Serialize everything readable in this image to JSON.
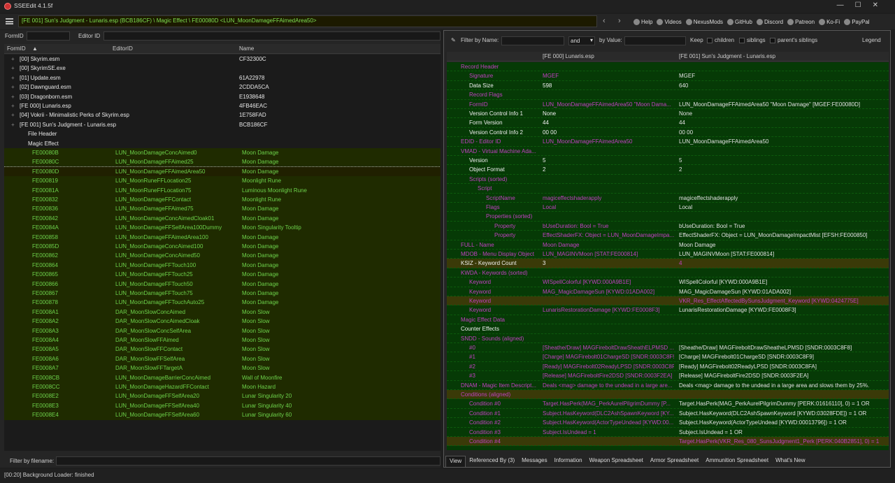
{
  "app": {
    "title": "SSEEdit 4.1.5f"
  },
  "path": "[FE 001] Sun's Judgment - Lunaris.esp (BCB186CF) \\ Magic Effect \\ FE00080D <LUN_MoonDamageFFAimedArea50>",
  "links": [
    {
      "label": "Help",
      "icon": "book-icon"
    },
    {
      "label": "Videos",
      "icon": "video-icon"
    },
    {
      "label": "NexusMods",
      "icon": "nexus-icon"
    },
    {
      "label": "GitHub",
      "icon": "github-icon"
    },
    {
      "label": "Discord",
      "icon": "discord-icon"
    },
    {
      "label": "Patreon",
      "icon": "patreon-icon"
    },
    {
      "label": "Ko-Fi",
      "icon": "kofi-icon"
    },
    {
      "label": "PayPal",
      "icon": "paypal-icon"
    }
  ],
  "left": {
    "formid_label": "FormID",
    "editorid_label": "Editor ID",
    "columns": [
      "FormID",
      "EditorID",
      "Name"
    ],
    "files": [
      {
        "label": "[00] Skyrim.esm",
        "hash": "CF32300C"
      },
      {
        "label": "[00] SkyrimSE.exe",
        "hash": ""
      },
      {
        "label": "[01] Update.esm",
        "hash": "61A22978"
      },
      {
        "label": "[02] Dawnguard.esm",
        "hash": "2CDDA5CA"
      },
      {
        "label": "[03] Dragonborn.esm",
        "hash": "E1938648"
      },
      {
        "label": "[FE 000] Lunaris.esp",
        "hash": "4FB46EAC"
      },
      {
        "label": "[04] Vokrii - Minimalistic Perks of Skyrim.esp",
        "hash": "1E758FAD"
      },
      {
        "label": "[FE 001] Sun's Judgment - Lunaris.esp",
        "hash": "BCB186CF"
      }
    ],
    "file_header": "File Header",
    "magic_effect": "Magic Effect",
    "records": [
      [
        "FE00080B",
        "LUN_MoonDamageConcAimed0",
        "Moon Damage"
      ],
      [
        "FE00080C",
        "LUN_MoonDamageFFAimed25",
        "Moon Damage"
      ],
      [
        "FE00080D",
        "LUN_MoonDamageFFAimedArea50",
        "Moon Damage"
      ],
      [
        "FE000819",
        "LUN_MoonRuneFFLocation25",
        "Moonlight Rune"
      ],
      [
        "FE00081A",
        "LUN_MoonRuneFFLocation75",
        "Luminous Moonlight Rune"
      ],
      [
        "FE000832",
        "LUN_MoonDamageFFContact",
        "Moonlight Rune"
      ],
      [
        "FE000836",
        "LUN_MoonDamageFFAimed75",
        "Moon Damage"
      ],
      [
        "FE000842",
        "LUN_MoonDamageConcAimedCloak01",
        "Moon Damage"
      ],
      [
        "FE00084A",
        "LUN_MoonDamageFFSelfArea100Dummy",
        "Moon Singularity Tooltip"
      ],
      [
        "FE000858",
        "LUN_MoonDamageFFAimedArea100",
        "Moon Damage"
      ],
      [
        "FE00085D",
        "LUN_MoonDamageConcAimed100",
        "Moon Damage"
      ],
      [
        "FE000862",
        "LUN_MoonDamageConcAimed50",
        "Moon Damage"
      ],
      [
        "FE000864",
        "LUN_MoonDamageFFTouch100",
        "Moon Damage"
      ],
      [
        "FE000865",
        "LUN_MoonDamageFFTouch25",
        "Moon Damage"
      ],
      [
        "FE000866",
        "LUN_MoonDamageFFTouch50",
        "Moon Damage"
      ],
      [
        "FE000867",
        "LUN_MoonDamageFFTouch75",
        "Moon Damage"
      ],
      [
        "FE000878",
        "LUN_MoonDamageFFTouchAuto25",
        "Moon Damage"
      ],
      [
        "FE0008A1",
        "DAR_MoonSlowConcAimed",
        "Moon Slow"
      ],
      [
        "FE0008A2",
        "DAR_MoonSlowConcAimedCloak",
        "Moon Slow"
      ],
      [
        "FE0008A3",
        "DAR_MoonSlowConcSelfArea",
        "Moon Slow"
      ],
      [
        "FE0008A4",
        "DAR_MoonSlowFFAimed",
        "Moon Slow"
      ],
      [
        "FE0008A5",
        "DAR_MoonSlowFFContact",
        "Moon Slow"
      ],
      [
        "FE0008A6",
        "DAR_MoonSlowFFSelfArea",
        "Moon Slow"
      ],
      [
        "FE0008A7",
        "DAR_MoonSlowFFTargetA",
        "Moon Slow"
      ],
      [
        "FE0008CB",
        "LUN_MoonDamageBarrierConcAimed",
        "Wall of Moonfire"
      ],
      [
        "FE0008CC",
        "LUN_MoonDamageHazardFFContact",
        "Moon Hazard"
      ],
      [
        "FE0008E2",
        "LUN_MoonDamageFFSelfArea20",
        "Lunar Singularity 20"
      ],
      [
        "FE0008E3",
        "LUN_MoonDamageFFSelfArea40",
        "Lunar Singularity 40"
      ],
      [
        "FE0008E4",
        "LUN_MoonDamageFFSelfArea60",
        "Lunar Singularity 60"
      ]
    ],
    "filename_label": "Filter by filename:"
  },
  "right": {
    "filter_name_label": "Filter by Name:",
    "and_value": "and",
    "by_value_label": "by Value:",
    "keep_label": "Keep",
    "children_label": "children",
    "siblings_label": "siblings",
    "parents_label": "parent's siblings",
    "legend_label": "Legend",
    "col1": "[FE 000] Lunaris.esp",
    "col2": "[FE 001] Sun's Judgment - Lunaris.esp",
    "rows": [
      {
        "k": "Record Header",
        "v1": "",
        "v2": "",
        "cls": "hdr",
        "ind": 0
      },
      {
        "k": "Signature",
        "v1": "MGEF",
        "v2": "MGEF",
        "cls": "dim",
        "ind": 1
      },
      {
        "k": "Data Size",
        "v1": "598",
        "v2": "640",
        "cls": "plain",
        "ind": 1
      },
      {
        "k": "Record Flags",
        "v1": "",
        "v2": "",
        "cls": "hdr",
        "ind": 1
      },
      {
        "k": "FormID",
        "v1": "LUN_MoonDamageFFAimedArea50 \"Moon Dama...",
        "v2": "LUN_MoonDamageFFAimedArea50 \"Moon Damage\" [MGEF:FE00080D]",
        "cls": "dim",
        "ind": 1
      },
      {
        "k": "Version Control Info 1",
        "v1": "None",
        "v2": "None",
        "cls": "plain",
        "ind": 1
      },
      {
        "k": "Form Version",
        "v1": "44",
        "v2": "44",
        "cls": "plain",
        "ind": 1
      },
      {
        "k": "Version Control Info 2",
        "v1": "00 00",
        "v2": "00 00",
        "cls": "plain",
        "ind": 1
      },
      {
        "k": "EDID - Editor ID",
        "v1": "LUN_MoonDamageFFAimedArea50",
        "v2": "LUN_MoonDamageFFAimedArea50",
        "cls": "dim",
        "ind": 0
      },
      {
        "k": "VMAD - Virtual Machine Ada...",
        "v1": "",
        "v2": "",
        "cls": "hdr",
        "ind": 0
      },
      {
        "k": "Version",
        "v1": "5",
        "v2": "5",
        "cls": "plain",
        "ind": 1
      },
      {
        "k": "Object Format",
        "v1": "2",
        "v2": "2",
        "cls": "plain",
        "ind": 1
      },
      {
        "k": "Scripts (sorted)",
        "v1": "",
        "v2": "",
        "cls": "hdr",
        "ind": 1
      },
      {
        "k": "Script",
        "v1": "",
        "v2": "",
        "cls": "hdr",
        "ind": 2
      },
      {
        "k": "ScriptName",
        "v1": "magiceffectshaderapply",
        "v2": "magiceffectshaderapply",
        "cls": "dim",
        "ind": 3
      },
      {
        "k": "Flags",
        "v1": "Local",
        "v2": "Local",
        "cls": "dim",
        "ind": 3
      },
      {
        "k": "Properties (sorted)",
        "v1": "",
        "v2": "",
        "cls": "hdr",
        "ind": 3
      },
      {
        "k": "Property",
        "v1": "bUseDuration: Bool = True",
        "v2": "bUseDuration: Bool = True",
        "cls": "dim",
        "ind": 4
      },
      {
        "k": "Property",
        "v1": "EffectShaderFX: Object = LUN_MoonDamageImpa...",
        "v2": "EffectShaderFX: Object = LUN_MoonDamageImpactMist [EFSH:FE000850]",
        "cls": "dim",
        "ind": 4
      },
      {
        "k": "FULL - Name",
        "v1": "Moon Damage",
        "v2": "Moon Damage",
        "cls": "dim",
        "ind": 0
      },
      {
        "k": "MDOB - Menu Display Object",
        "v1": "LUN_MAGINVMoon [STAT:FE000814]",
        "v2": "LUN_MAGINVMoon [STAT:FE000814]",
        "cls": "dim",
        "ind": 0
      },
      {
        "k": "KSIZ - Keyword Count",
        "v1": "3",
        "v2": "4",
        "cls": "conflict plain",
        "ind": 0
      },
      {
        "k": "KWDA - Keywords (sorted)",
        "v1": "",
        "v2": "",
        "cls": "hdr",
        "ind": 0
      },
      {
        "k": "Keyword",
        "v1": "WISpellColorful [KYWD:000A9B1E]",
        "v2": "WISpellColorful [KYWD:000A9B1E]",
        "cls": "dim",
        "ind": 1
      },
      {
        "k": "Keyword",
        "v1": "MAG_MagicDamageSun [KYWD:01ADA002]",
        "v2": "MAG_MagicDamageSun [KYWD:01ADA002]",
        "cls": "dim",
        "ind": 1
      },
      {
        "k": "Keyword",
        "v1": "",
        "v2": "VKR_Res_EffectAffectedBySunsJudgment_Keyword [KYWD:0424775E]",
        "cls": "conflict",
        "ind": 1
      },
      {
        "k": "Keyword",
        "v1": "LunarisRestorationDamage [KYWD:FE0008F3]",
        "v2": "LunarisRestorationDamage [KYWD:FE0008F3]",
        "cls": "dim",
        "ind": 1
      },
      {
        "k": "Magic Effect Data",
        "v1": "",
        "v2": "",
        "cls": "hdr",
        "ind": 0
      },
      {
        "k": "Counter Effects",
        "v1": "",
        "v2": "",
        "cls": "plain",
        "ind": 0
      },
      {
        "k": "SNDD - Sounds (aligned)",
        "v1": "",
        "v2": "",
        "cls": "hdr",
        "ind": 0
      },
      {
        "k": "#0",
        "v1": "[Sheathe/Draw] MAGFireboltDrawSheathELPMSD ...",
        "v2": "[Sheathe/Draw] MAGFireboltDrawSheatheLPMSD [SNDR:0003C8F8]",
        "cls": "dim",
        "ind": 1
      },
      {
        "k": "#1",
        "v1": "[Charge] MAGFirebolt01ChargeSD [SNDR:0003C8F9]",
        "v2": "[Charge] MAGFirebolt01ChargeSD [SNDR:0003C8F9]",
        "cls": "dim",
        "ind": 1
      },
      {
        "k": "#2",
        "v1": "[Ready] MAGFirebolt02ReadyLPSD [SNDR:0003C8F...",
        "v2": "[Ready] MAGFirebolt02ReadyLPSD [SNDR:0003C8FA]",
        "cls": "dim",
        "ind": 1
      },
      {
        "k": "#3",
        "v1": "[Release] MAGFireboltFire2DSD [SNDR:0003F2EA]",
        "v2": "[Release] MAGFireboltFire2DSD [SNDR:0003F2EA]",
        "cls": "dim",
        "ind": 1
      },
      {
        "k": "DNAM - Magic Item Descript...",
        "v1": "Deals <mag> damage to the undead in a large are...",
        "v2": "Deals <mag> damage to the undead in a large area and slows them by 25%.",
        "cls": "dim",
        "ind": 0
      },
      {
        "k": "Conditions (aligned)",
        "v1": "",
        "v2": "",
        "cls": "hdr conflict",
        "ind": 0
      },
      {
        "k": "Condition #0",
        "v1": "Target.HasPerk(MAG_PerkAurelPilgrimDummy [P...",
        "v2": "Target.HasPerk(MAG_PerkAurelPilgrimDummy [PERK:01616110], 0) = 1 OR",
        "cls": "dim",
        "ind": 1
      },
      {
        "k": "Condition #1",
        "v1": "Subject.HasKeyword(DLC2AshSpawnKeyword [KY...",
        "v2": "Subject.HasKeyword(DLC2AshSpawnKeyword [KYWD:03028FDE]) = 1 OR",
        "cls": "dim",
        "ind": 1
      },
      {
        "k": "Condition #2",
        "v1": "Subject.HasKeyword(ActorTypeUndead [KYWD:00...",
        "v2": "Subject.HasKeyword(ActorTypeUndead [KYWD:00013796]) = 1 OR",
        "cls": "dim",
        "ind": 1
      },
      {
        "k": "Condition #3",
        "v1": "Subject.IsUndead = 1",
        "v2": "Subject.IsUndead = 1 OR",
        "cls": "dim",
        "ind": 1
      },
      {
        "k": "Condition #4",
        "v1": "",
        "v2": "Target.HasPerk(VKR_Res_080_SunsJudgment1_Perk [PERK:040B2851], 0) = 1",
        "cls": "conflict",
        "ind": 1
      }
    ],
    "tabs": [
      "View",
      "Referenced By (3)",
      "Messages",
      "Information",
      "Weapon Spreadsheet",
      "Armor Spreadsheet",
      "Ammunition Spreadsheet",
      "What's New"
    ]
  },
  "status": "[00:20] Background Loader: finished"
}
